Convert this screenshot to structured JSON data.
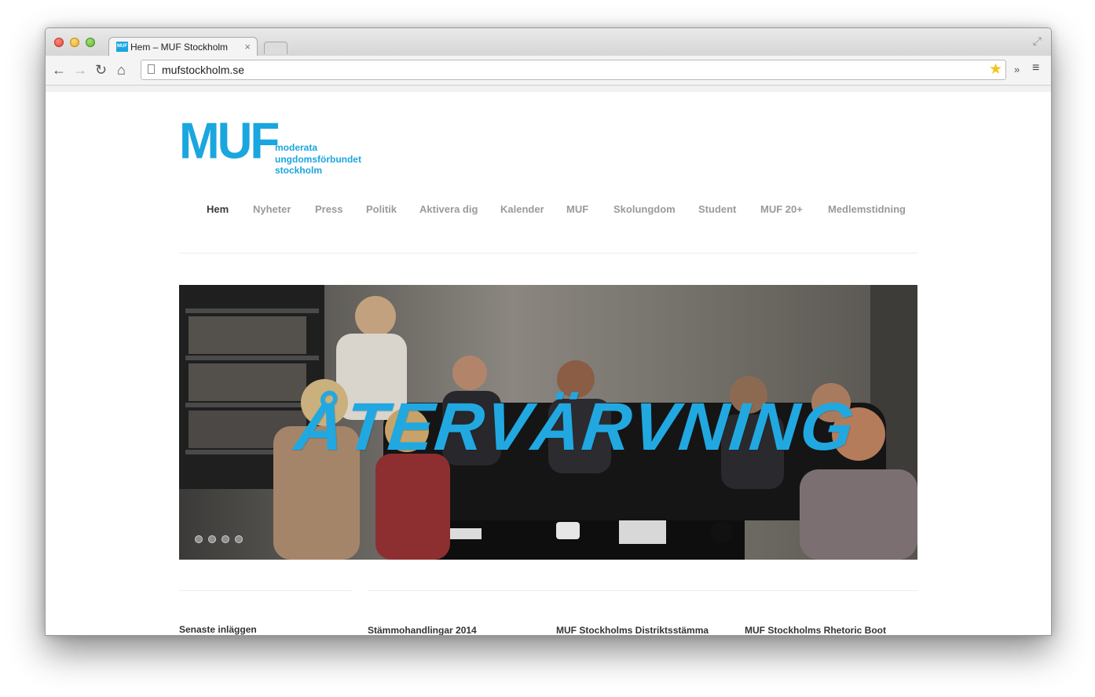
{
  "browser": {
    "tab_title": "Hem – MUF Stockholm",
    "tab_favicon_text": "MUF",
    "tab_close": "×",
    "url": "mufstockholm.se",
    "icons": {
      "back": "←",
      "forward": "→",
      "reload": "↻",
      "home": "⌂",
      "star": "★",
      "extensions": "»",
      "menu": "≡",
      "fullscreen": "⤢"
    }
  },
  "site": {
    "logo_mark": "MUF",
    "logo_line1": "moderata",
    "logo_line2": "ungdomsförbundet",
    "logo_line3": "stockholm",
    "brand_color": "#1aa6de",
    "nav": [
      {
        "label": "Hem",
        "active": true
      },
      {
        "label": "Nyheter"
      },
      {
        "label": "Press"
      },
      {
        "label": "Politik"
      },
      {
        "label": "Aktivera dig"
      },
      {
        "label": "Kalender"
      },
      {
        "label": "MUF"
      },
      {
        "label": "Skolungdom"
      },
      {
        "label": "Student"
      },
      {
        "label": "MUF 20+"
      },
      {
        "label": "Medlemstidning"
      }
    ],
    "hero": {
      "title": "ÅTERVÄRVNING",
      "slides": 4,
      "active_slide": 1
    },
    "sidebar_heading": "Senaste inläggen",
    "posts": [
      {
        "title": "Stämmohandlingar 2014"
      },
      {
        "title": "MUF Stockholms Distriktsstämma"
      },
      {
        "title": "MUF Stockholms Rhetoric Boot"
      }
    ]
  }
}
